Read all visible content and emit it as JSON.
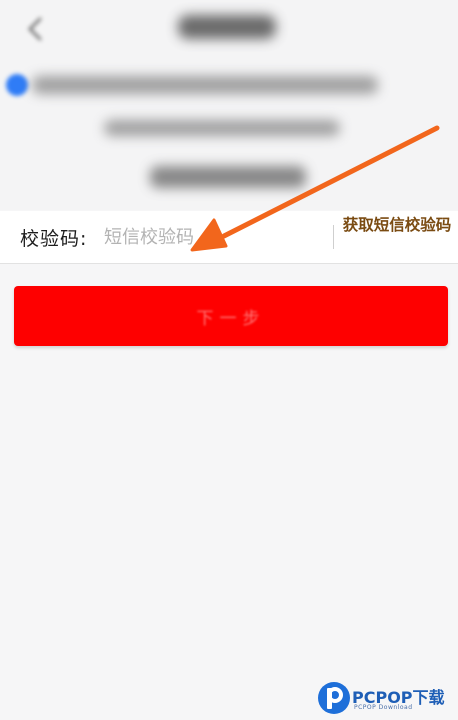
{
  "form": {
    "code_label": "校验码:",
    "code_placeholder": "短信校验码",
    "code_value": "",
    "get_code_label": "获取短信校验码",
    "next_button_label": "下一步"
  },
  "watermark": {
    "brand": "PCPOP下载",
    "sub": "PCPOP Download"
  },
  "colors": {
    "button_red": "#fe0000",
    "get_code_text": "#7a4b12",
    "arrow_orange": "#f2661c",
    "checkbox_blue": "#2f7cf6",
    "watermark_blue": "#1e5eb6"
  },
  "icons": {
    "back": "chevron-left-icon",
    "checkbox": "checkbox-checked-icon",
    "arrow": "annotation-arrow",
    "logo": "pcpop-logo"
  }
}
